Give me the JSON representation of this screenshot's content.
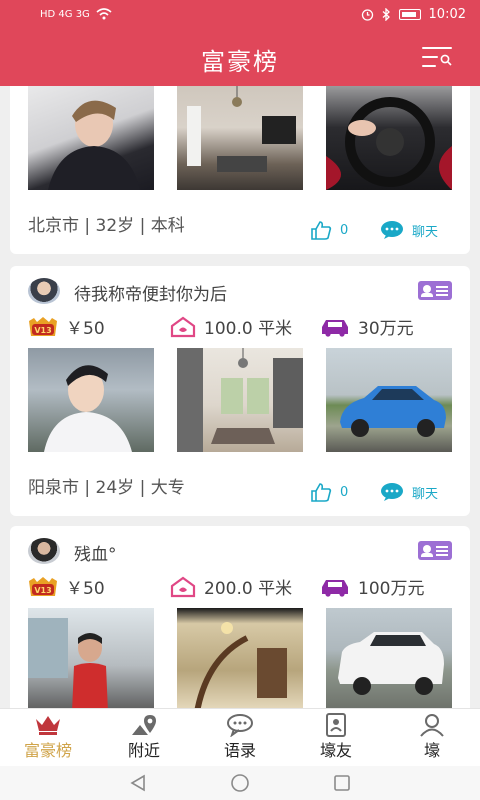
{
  "status_bar": {
    "left": "HD 4G 3G",
    "time": "10:02"
  },
  "header": {
    "title": "富豪榜"
  },
  "cards": [
    {
      "meta": "北京市 | 32岁 | 本科",
      "like_count": "0",
      "chat_label": "聊天"
    },
    {
      "username": "待我称帝便封你为后",
      "vip_level": "V13",
      "money": "￥50",
      "house": "100.0 平米",
      "car": "30万元",
      "meta": "阳泉市 | 24岁 | 大专",
      "like_count": "0",
      "chat_label": "聊天"
    },
    {
      "username": "残血°",
      "vip_level": "V13",
      "money": "￥50",
      "house": "200.0 平米",
      "car": "100万元"
    }
  ],
  "tabs": [
    {
      "label": "富豪榜",
      "icon": "crown-icon",
      "active": true
    },
    {
      "label": "附近",
      "icon": "map-pin-icon",
      "active": false
    },
    {
      "label": "语录",
      "icon": "speech-bubble-icon",
      "active": false
    },
    {
      "label": "壕友",
      "icon": "contacts-icon",
      "active": false
    },
    {
      "label": "壕",
      "icon": "profile-icon",
      "active": false
    }
  ],
  "colors": {
    "brand": "#e0475a",
    "accent_teal": "#1aa8c7",
    "vip_purple": "#9c6fd4",
    "tab_active": "#d0a44a"
  }
}
